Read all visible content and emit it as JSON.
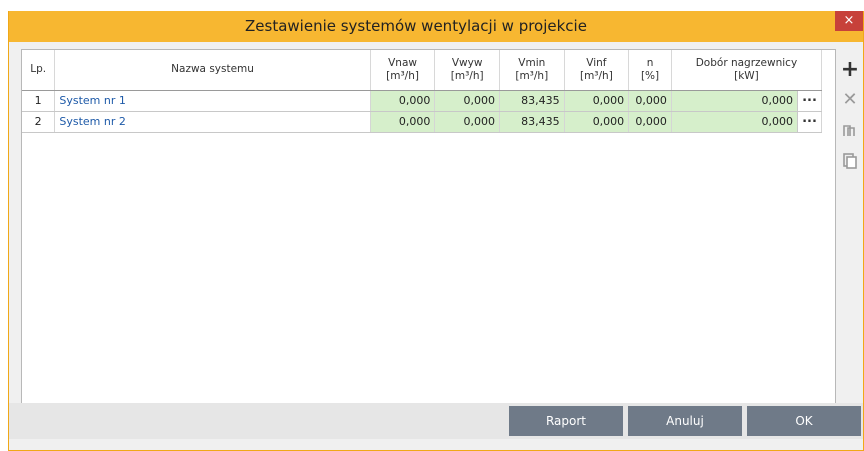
{
  "window": {
    "title": "Zestawienie systemów wentylacji w projekcie",
    "close_label": "×"
  },
  "table": {
    "headers": {
      "lp": "Lp.",
      "name": "Nazwa systemu",
      "vnaw_1": "Vnaw",
      "vnaw_2": "[m³/h]",
      "vwyw_1": "Vwyw",
      "vwyw_2": "[m³/h]",
      "vmin_1": "Vmin",
      "vmin_2": "[m³/h]",
      "vinf_1": "Vinf",
      "vinf_2": "[m³/h]",
      "n_1": "n",
      "n_2": "[%]",
      "dobor_1": "Dobór nagrzewnicy",
      "dobor_2": "[kW]"
    },
    "rows": [
      {
        "lp": "1",
        "name": "System nr 1",
        "vnaw": "0,000",
        "vwyw": "0,000",
        "vmin": "83,435",
        "vinf": "0,000",
        "n": "0,000",
        "dobor": "0,000"
      },
      {
        "lp": "2",
        "name": "System nr 2",
        "vnaw": "0,000",
        "vwyw": "0,000",
        "vmin": "83,435",
        "vinf": "0,000",
        "n": "0,000",
        "dobor": "0,000"
      }
    ],
    "more_label": "..."
  },
  "tools": {
    "add_icon": "plus-icon",
    "delete_icon": "close-icon",
    "copy_icon": "copy-icon",
    "paste_icon": "paste-icon"
  },
  "buttons": {
    "raport": "Raport",
    "anuluj": "Anuluj",
    "ok": "OK"
  },
  "colors": {
    "title_bar": "#f7b731",
    "value_cell": "#d6efcb",
    "button": "#6f7a88",
    "close": "#c7413a"
  }
}
